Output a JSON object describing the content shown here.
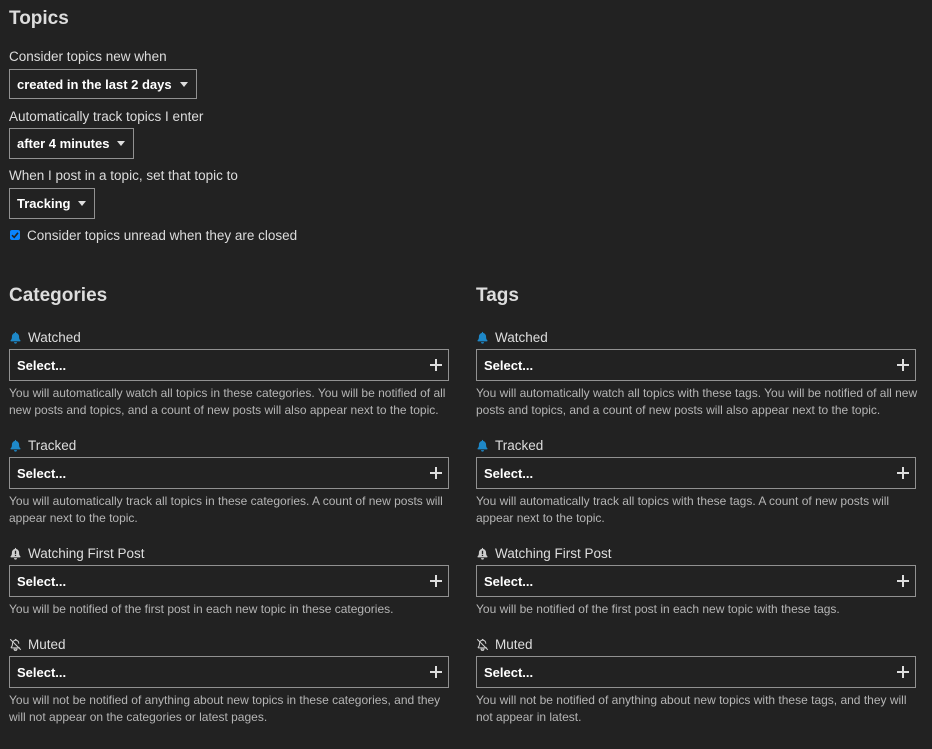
{
  "topics": {
    "title": "Topics",
    "new_label": "Consider topics new when",
    "new_value": "created in the last 2 days",
    "track_label": "Automatically track topics I enter",
    "track_value": "after 4 minutes",
    "post_label": "When I post in a topic, set that topic to",
    "post_value": "Tracking",
    "unread_label": "Consider topics unread when they are closed",
    "unread_checked": true
  },
  "categories": {
    "title": "Categories",
    "groups": [
      {
        "label": "Watched",
        "icon": "bell-icon",
        "placeholder": "Select...",
        "desc": "You will automatically watch all topics in these categories. You will be notified of all new posts and topics, and a count of new posts will also appear next to the topic."
      },
      {
        "label": "Tracked",
        "icon": "bell-icon",
        "placeholder": "Select...",
        "desc": "You will automatically track all topics in these categories. A count of new posts will appear next to the topic."
      },
      {
        "label": "Watching First Post",
        "icon": "bell-exclamation-icon",
        "placeholder": "Select...",
        "desc": "You will be notified of the first post in each new topic in these categories."
      },
      {
        "label": "Muted",
        "icon": "bell-slash-icon",
        "placeholder": "Select...",
        "desc": "You will not be notified of anything about new topics in these categories, and they will not appear on the categories or latest pages."
      }
    ]
  },
  "tags": {
    "title": "Tags",
    "groups": [
      {
        "label": "Watched",
        "icon": "bell-icon",
        "placeholder": "Select...",
        "desc": "You will automatically watch all topics with these tags. You will be notified of all new posts and topics, and a count of new posts will also appear next to the topic."
      },
      {
        "label": "Tracked",
        "icon": "bell-icon",
        "placeholder": "Select...",
        "desc": "You will automatically track all topics with these tags. A count of new posts will appear next to the topic."
      },
      {
        "label": "Watching First Post",
        "icon": "bell-exclamation-icon",
        "placeholder": "Select...",
        "desc": "You will be notified of the first post in each new topic with these tags."
      },
      {
        "label": "Muted",
        "icon": "bell-slash-icon",
        "placeholder": "Select...",
        "desc": "You will not be notified of anything about new topics with these tags, and they will not appear in latest."
      }
    ]
  },
  "colors": {
    "background": "#222222",
    "text": "#dddddd",
    "bell_accent": "#1e88c8",
    "checkbox": "#0a84ff"
  }
}
